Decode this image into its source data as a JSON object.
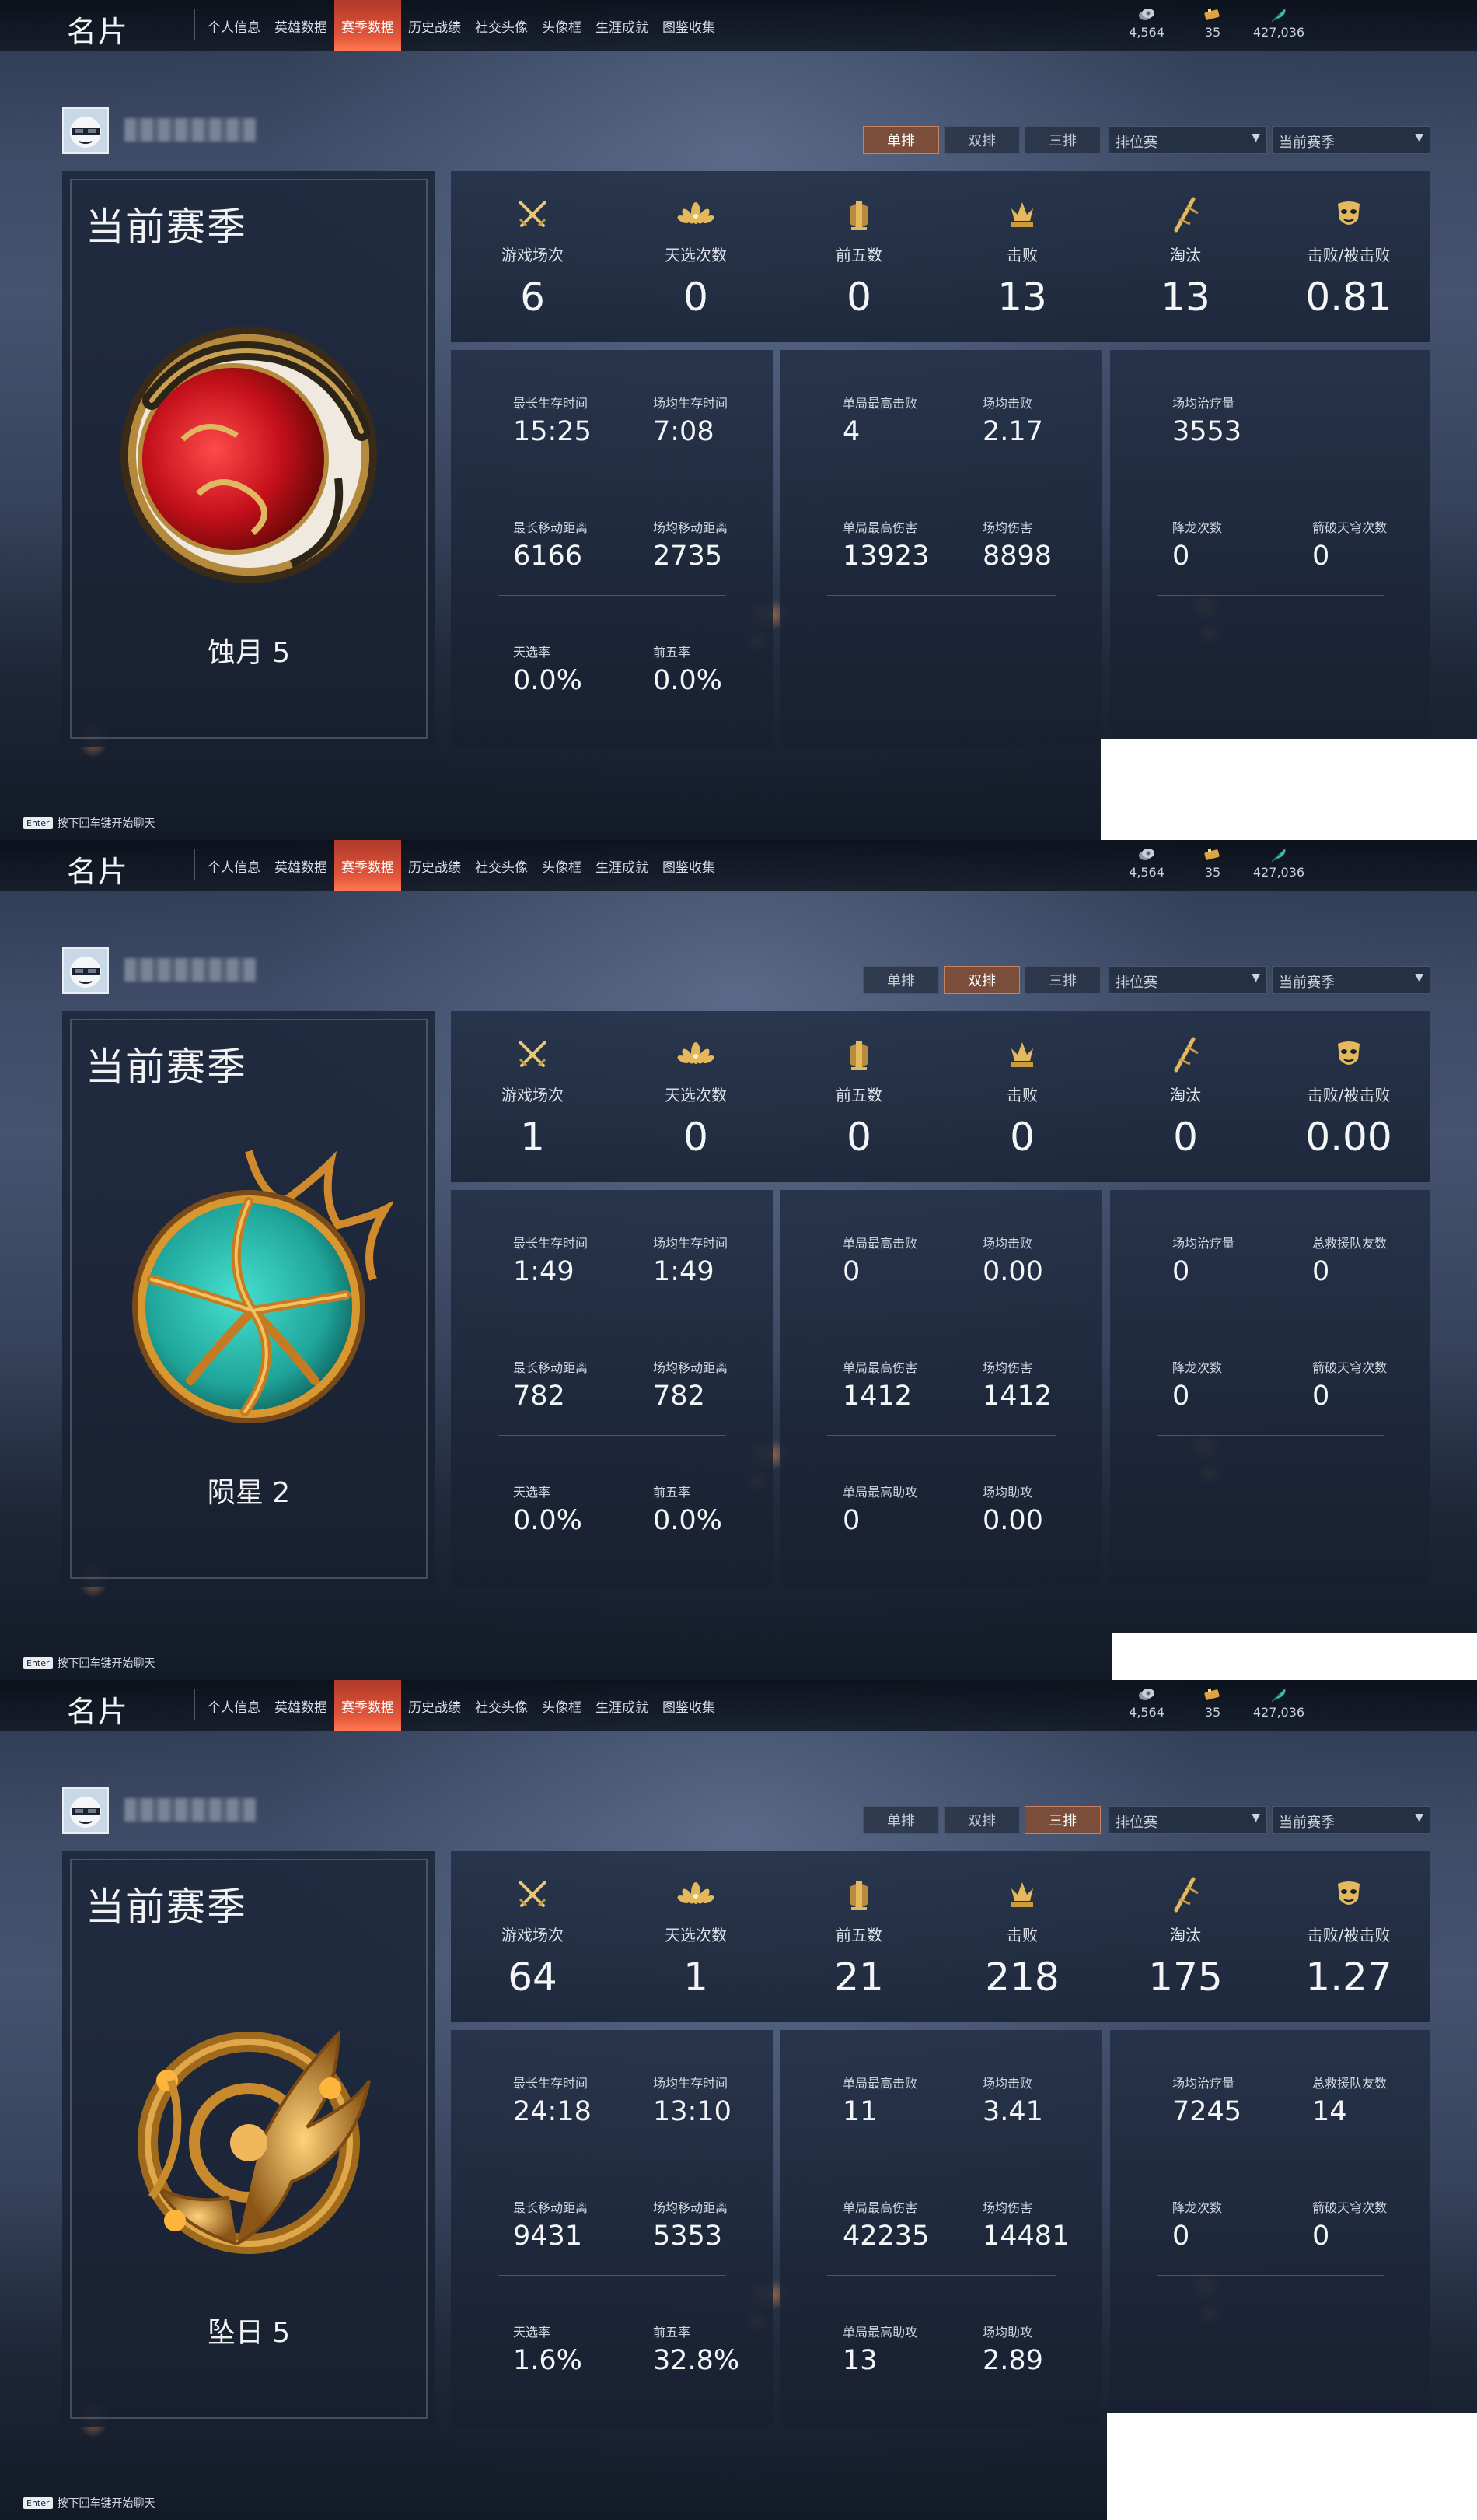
{
  "app": {
    "title": "名片",
    "tabs": [
      "个人信息",
      "英雄数据",
      "赛季数据",
      "历史战绩",
      "社交头像",
      "头像框",
      "生涯成就",
      "图鉴收集"
    ],
    "active_tab": 2,
    "currencies": [
      {
        "icon": "coin-icon",
        "value": "4,564"
      },
      {
        "icon": "ticket-icon",
        "value": "35"
      },
      {
        "icon": "feather-icon",
        "value": "427,036"
      }
    ],
    "mode_options": [
      "单排",
      "双排",
      "三排"
    ],
    "queue_select": "排位赛",
    "season_select": "当前赛季",
    "chat_hint_key": "Enter",
    "chat_hint": "按下回车键开始聊天",
    "season_title": "当前赛季"
  },
  "colors": {
    "accent": "#e2553a",
    "active_seg": "#7a4e3b",
    "panel": "#222e44"
  },
  "top_labels": [
    "游戏场次",
    "天选次数",
    "前五数",
    "击败",
    "淘汰",
    "击败/被击败"
  ],
  "top_icons": [
    "crossed-swords-icon",
    "lotus-icon",
    "pillar-icon",
    "trident-crown-icon",
    "slash-icon",
    "mask-icon"
  ],
  "screens": [
    {
      "mode_active": 0,
      "rank": "蚀月 5",
      "emblem": "crescent-moon-emblem",
      "top_values": [
        "6",
        "0",
        "0",
        "13",
        "13",
        "0.81"
      ],
      "col1": [
        [
          {
            "label": "最长生存时间",
            "value": "15:25"
          },
          {
            "label": "场均生存时间",
            "value": "7:08"
          }
        ],
        [
          {
            "label": "最长移动距离",
            "value": "6166"
          },
          {
            "label": "场均移动距离",
            "value": "2735"
          }
        ],
        [
          {
            "label": "天选率",
            "value": "0.0%"
          },
          {
            "label": "前五率",
            "value": "0.0%"
          }
        ]
      ],
      "col2": [
        [
          {
            "label": "单局最高击败",
            "value": "4"
          },
          {
            "label": "场均击败",
            "value": "2.17"
          }
        ],
        [
          {
            "label": "单局最高伤害",
            "value": "13923"
          },
          {
            "label": "场均伤害",
            "value": "8898"
          }
        ]
      ],
      "col3": [
        [
          {
            "label": "场均治疗量",
            "value": "3553"
          }
        ],
        [
          {
            "label": "降龙次数",
            "value": "0"
          },
          {
            "label": "箭破天穹次数",
            "value": "0"
          }
        ]
      ]
    },
    {
      "mode_active": 1,
      "rank": "陨星 2",
      "emblem": "meteor-emblem",
      "top_values": [
        "1",
        "0",
        "0",
        "0",
        "0",
        "0.00"
      ],
      "col1": [
        [
          {
            "label": "最长生存时间",
            "value": "1:49"
          },
          {
            "label": "场均生存时间",
            "value": "1:49"
          }
        ],
        [
          {
            "label": "最长移动距离",
            "value": "782"
          },
          {
            "label": "场均移动距离",
            "value": "782"
          }
        ],
        [
          {
            "label": "天选率",
            "value": "0.0%"
          },
          {
            "label": "前五率",
            "value": "0.0%"
          }
        ]
      ],
      "col2": [
        [
          {
            "label": "单局最高击败",
            "value": "0"
          },
          {
            "label": "场均击败",
            "value": "0.00"
          }
        ],
        [
          {
            "label": "单局最高伤害",
            "value": "1412"
          },
          {
            "label": "场均伤害",
            "value": "1412"
          }
        ],
        [
          {
            "label": "单局最高助攻",
            "value": "0"
          },
          {
            "label": "场均助攻",
            "value": "0.00"
          }
        ]
      ],
      "col3": [
        [
          {
            "label": "场均治疗量",
            "value": "0"
          },
          {
            "label": "总救援队友数",
            "value": "0"
          }
        ],
        [
          {
            "label": "降龙次数",
            "value": "0"
          },
          {
            "label": "箭破天穹次数",
            "value": "0"
          }
        ]
      ]
    },
    {
      "mode_active": 2,
      "rank": "坠日 5",
      "emblem": "phoenix-sun-emblem",
      "top_values": [
        "64",
        "1",
        "21",
        "218",
        "175",
        "1.27"
      ],
      "col1": [
        [
          {
            "label": "最长生存时间",
            "value": "24:18"
          },
          {
            "label": "场均生存时间",
            "value": "13:10"
          }
        ],
        [
          {
            "label": "最长移动距离",
            "value": "9431"
          },
          {
            "label": "场均移动距离",
            "value": "5353"
          }
        ],
        [
          {
            "label": "天选率",
            "value": "1.6%"
          },
          {
            "label": "前五率",
            "value": "32.8%"
          }
        ]
      ],
      "col2": [
        [
          {
            "label": "单局最高击败",
            "value": "11"
          },
          {
            "label": "场均击败",
            "value": "3.41"
          }
        ],
        [
          {
            "label": "单局最高伤害",
            "value": "42235"
          },
          {
            "label": "场均伤害",
            "value": "14481"
          }
        ],
        [
          {
            "label": "单局最高助攻",
            "value": "13"
          },
          {
            "label": "场均助攻",
            "value": "2.89"
          }
        ]
      ],
      "col3": [
        [
          {
            "label": "场均治疗量",
            "value": "7245"
          },
          {
            "label": "总救援队友数",
            "value": "14"
          }
        ],
        [
          {
            "label": "降龙次数",
            "value": "0"
          },
          {
            "label": "箭破天穹次数",
            "value": "0"
          }
        ]
      ]
    }
  ]
}
